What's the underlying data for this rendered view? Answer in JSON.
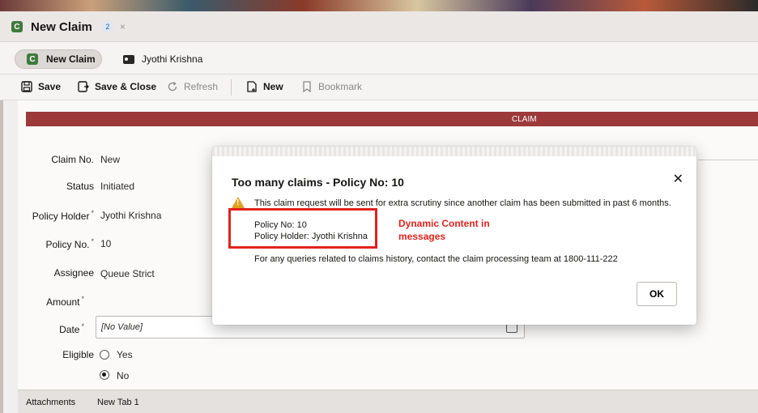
{
  "tab": {
    "title": "New Claim",
    "count": "2",
    "close": "×",
    "icon_letter": "C"
  },
  "crumb": {
    "pill_label": "New Claim",
    "person": "Jyothi Krishna"
  },
  "toolbar": {
    "save": "Save",
    "save_close": "Save & Close",
    "refresh": "Refresh",
    "new": "New",
    "bookmark": "Bookmark"
  },
  "section": {
    "header": "CLAIM"
  },
  "form": {
    "claim_no_label": "Claim No.",
    "claim_no_value": "New",
    "status_label": "Status",
    "status_value": "Initiated",
    "policy_holder_label": "Policy Holder",
    "policy_holder_value": "Jyothi Krishna",
    "policy_no_label": "Policy No.",
    "policy_no_value": "10",
    "assignee_label": "Assignee",
    "assignee_value": "Queue Strict",
    "amount_label": "Amount",
    "date_label": "Date",
    "date_value": "[No Value]",
    "eligible_label": "Eligible",
    "yes": "Yes",
    "no": "No",
    "required_mark": "*"
  },
  "attachments": {
    "label": "Attachments",
    "tab": "New Tab 1"
  },
  "dialog": {
    "title": "Too many claims - Policy No: 10",
    "close": "✕",
    "message": "This claim request will be sent for extra scrutiny since another claim has been submitted in past 6 months.",
    "policy_no_line": "Policy No: 10",
    "policy_holder_line": "Policy Holder:  Jyothi Krishna",
    "queries": "For any queries related to claims history, contact the claim processing team at 1800-111-222",
    "ok": "OK"
  },
  "annotation": {
    "line1": "Dynamic Content in",
    "line2": "messages"
  },
  "colors": {
    "claim_bar": "#9c3a3a",
    "annotation": "#e0231c",
    "warning": "#e0a21c",
    "brand_green": "#3f7a3d"
  }
}
